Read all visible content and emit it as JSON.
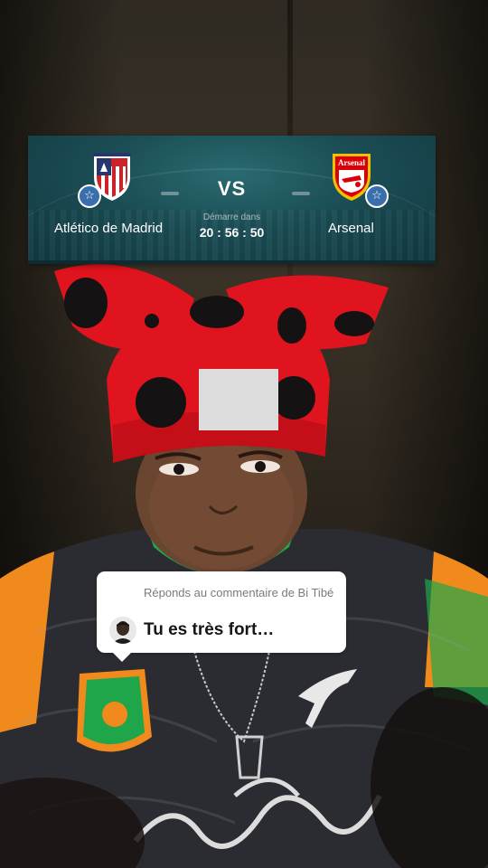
{
  "match": {
    "home_team": "Atlético de Madrid",
    "away_team": "Arsenal",
    "vs": "VS",
    "starts_in_label": "Démarre dans",
    "countdown": "20 : 56 : 50",
    "away_crest_text": "Arsenal",
    "favorite_icon": "star-icon"
  },
  "reply": {
    "header": "Réponds au commentaire de Bi Tibé",
    "comment": "Tu es très fort…"
  },
  "colors": {
    "card_bg": "#1b4d55",
    "badge_blue": "#3a6fae",
    "hat_red": "#e0141e",
    "jersey_orange": "#f08a1c",
    "jersey_green": "#1fa64a"
  }
}
